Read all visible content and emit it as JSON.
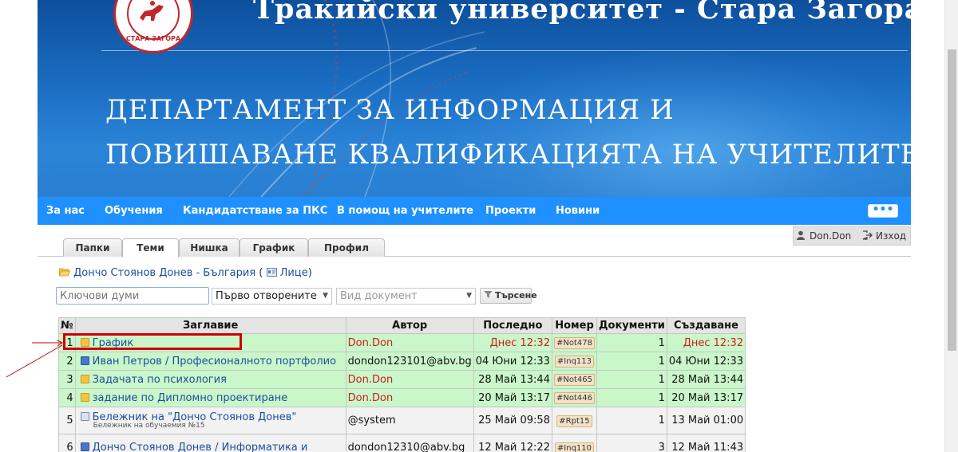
{
  "banner": {
    "university": "Тракийски университет - Стара Загора",
    "department_line1": "ДЕПАРТАМЕНТ ЗА ИНФОРМАЦИЯ И",
    "department_line2": "ПОВИШАВАНЕ КВАЛИФИКАЦИЯТА НА УЧИТЕЛИТЕ",
    "seal_text": "СТАРА ЗАГОРА"
  },
  "nav": {
    "items": [
      "За нас",
      "Обучения",
      "Кандидатстване за ПКС",
      "В помощ на учителите",
      "Проекти",
      "Новини"
    ],
    "more": "•••"
  },
  "user": {
    "name": "Don.Don",
    "logout": "Изход"
  },
  "tabs": [
    "Папки",
    "Теми",
    "Нишка",
    "График",
    "Профил"
  ],
  "active_tab": "Теми",
  "breadcrumb": {
    "title": "Дончо Стоянов Донев - България",
    "open": "(",
    "lica": "Лице",
    "close": ")"
  },
  "filters": {
    "keywords_placeholder": "Ключови думи",
    "sort_value": "Първо отворените",
    "doctype_placeholder": "Вид документ",
    "search_label": "Търсене"
  },
  "table": {
    "headers": [
      "№",
      "Заглавие",
      "Автор",
      "Последно",
      "Номер",
      "Документи",
      "Създаване"
    ],
    "rows": [
      {
        "n": "1",
        "title": "График",
        "sub": "",
        "author": "Don.Don",
        "last": "Днес 12:32",
        "tag": "#Not478",
        "docs": "1",
        "created": "Днес 12:32"
      },
      {
        "n": "2",
        "title": "Иван Петров / Професионалното портфолио",
        "sub": "",
        "author": "dondon123101@abv.bg",
        "last": "04 Юни 12:33",
        "tag": "#Inq113",
        "docs": "1",
        "created": "04 Юни 12:33"
      },
      {
        "n": "3",
        "title": "Задачата по психология",
        "sub": "",
        "author": "Don.Don",
        "last": "28 Май 13:44",
        "tag": "#Not465",
        "docs": "1",
        "created": "28 Май 13:44"
      },
      {
        "n": "4",
        "title": "задание по Дипломно проектиране",
        "sub": "",
        "author": "Don.Don",
        "last": "20 Май 13:17",
        "tag": "#Not446",
        "docs": "1",
        "created": "20 Май 13:17"
      },
      {
        "n": "5",
        "title": "Бележник на \"Дончо Стоянов Донев\"",
        "sub": "Бележник на обучаемия №15",
        "author": "@system",
        "last": "25 Май 09:58",
        "tag": "#Rpt15",
        "docs": "1",
        "created": "13 Май 01:00"
      },
      {
        "n": "6",
        "title": "Дончо Стоянов Донев / Информатика и",
        "sub": "",
        "author": "dondon12310@abv.bg",
        "last": "12 Май 12:22",
        "tag": "#Inq110",
        "docs": "3",
        "created": "12 Май 11:43"
      }
    ]
  },
  "colors": {
    "nav": "#1e90ff",
    "highlight": "#d10000",
    "row_green": "#c9f7c9",
    "author_red": "#d01c1c"
  }
}
